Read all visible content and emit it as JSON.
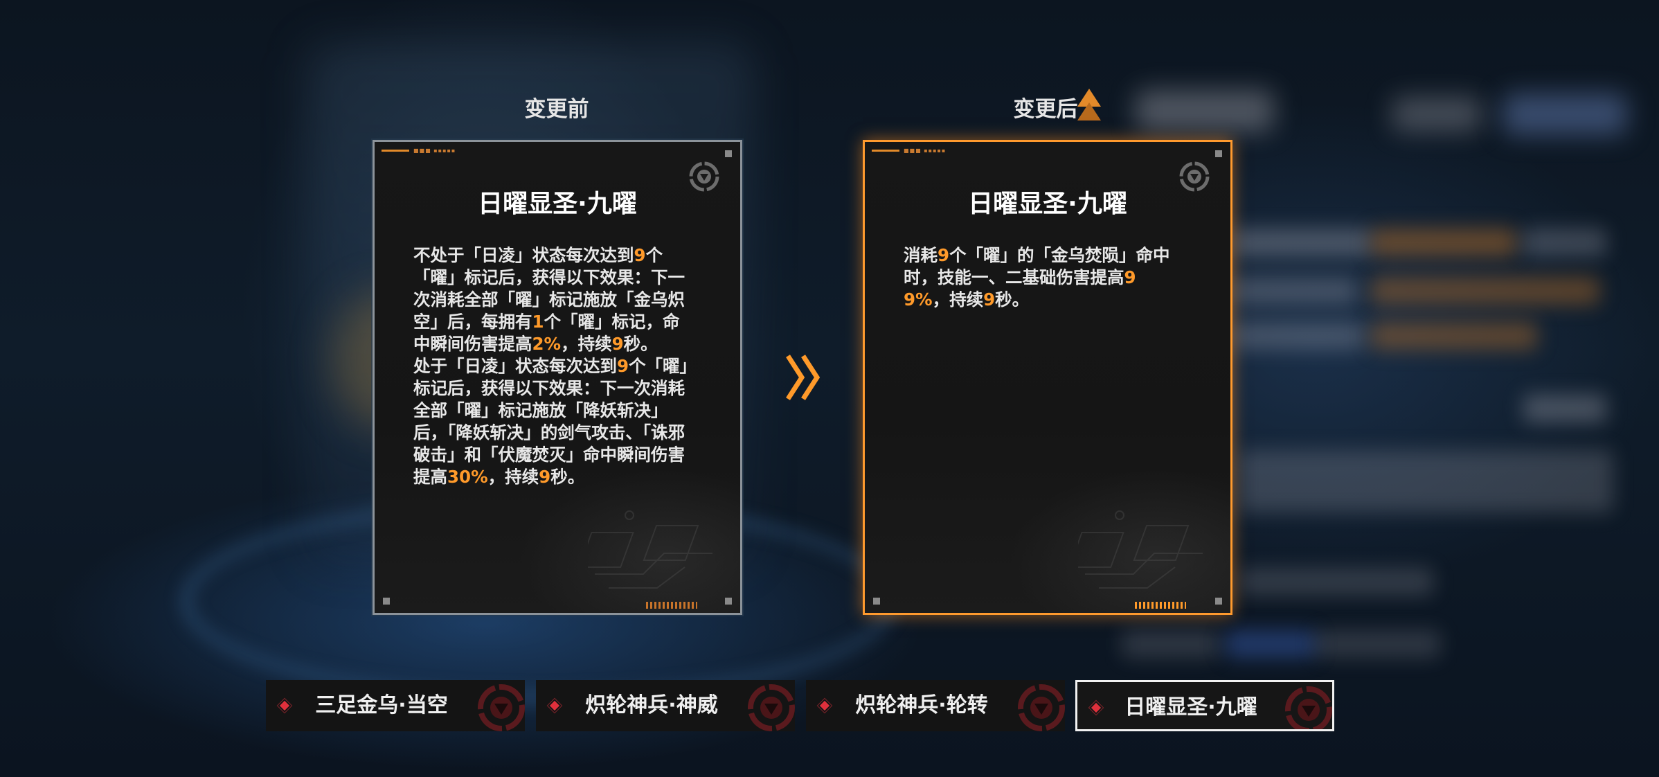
{
  "comparison": {
    "before_label": "变更前",
    "after_label": "变更后"
  },
  "before_card": {
    "title": "日曜显圣·九曜",
    "description_segments": [
      {
        "text": "不处于「日凌」状态每次达到",
        "hl": false
      },
      {
        "text": "9",
        "hl": true
      },
      {
        "text": "个「曜」标记后，获得以下效果：下一次消耗全部「曜」标记施放「金乌炽空」后，每拥有",
        "hl": false
      },
      {
        "text": "1",
        "hl": true
      },
      {
        "text": "个「曜」标记，命中瞬间伤害提高",
        "hl": false
      },
      {
        "text": "2%",
        "hl": true
      },
      {
        "text": "，持续",
        "hl": false
      },
      {
        "text": "9",
        "hl": true
      },
      {
        "text": "秒。\n处于「日凌」状态每次达到",
        "hl": false
      },
      {
        "text": "9",
        "hl": true
      },
      {
        "text": "个「曜」标记后，获得以下效果：下一次消耗全部「曜」标记施放「降妖斩决」后，「降妖斩决」的剑气攻击、「诛邪破击」和「伏魔焚灭」命中瞬间伤害提高",
        "hl": false
      },
      {
        "text": "30%",
        "hl": true
      },
      {
        "text": "，持续",
        "hl": false
      },
      {
        "text": "9",
        "hl": true
      },
      {
        "text": "秒。",
        "hl": false
      }
    ]
  },
  "after_card": {
    "title": "日曜显圣·九曜",
    "description_segments": [
      {
        "text": "消耗",
        "hl": false
      },
      {
        "text": "9",
        "hl": true
      },
      {
        "text": "个「曜」的「金乌焚陨」命中时，技能一、二基础伤害提高",
        "hl": false
      },
      {
        "text": "99%",
        "hl": true
      },
      {
        "text": "，持续",
        "hl": false
      },
      {
        "text": "9",
        "hl": true
      },
      {
        "text": "秒。",
        "hl": false
      }
    ]
  },
  "tabs": [
    {
      "label": "三足金乌·当空",
      "selected": false
    },
    {
      "label": "炽轮神兵·神威",
      "selected": false
    },
    {
      "label": "炽轮神兵·轮转",
      "selected": false
    },
    {
      "label": "日曜显圣·九曜",
      "selected": true
    }
  ],
  "icons": {
    "compare_arrow": "double-chevron-right-icon",
    "upgrade_marker": "up-arrow-icon",
    "card_emblem": "skill-emblem-icon",
    "tab_marker": "red-diamond-icon",
    "tab_badge": "skill-badge-icon"
  },
  "colors": {
    "highlight": "#ff9a2a",
    "selected_border": "#ff9a2e",
    "tab_diamond": "#e0303c"
  }
}
